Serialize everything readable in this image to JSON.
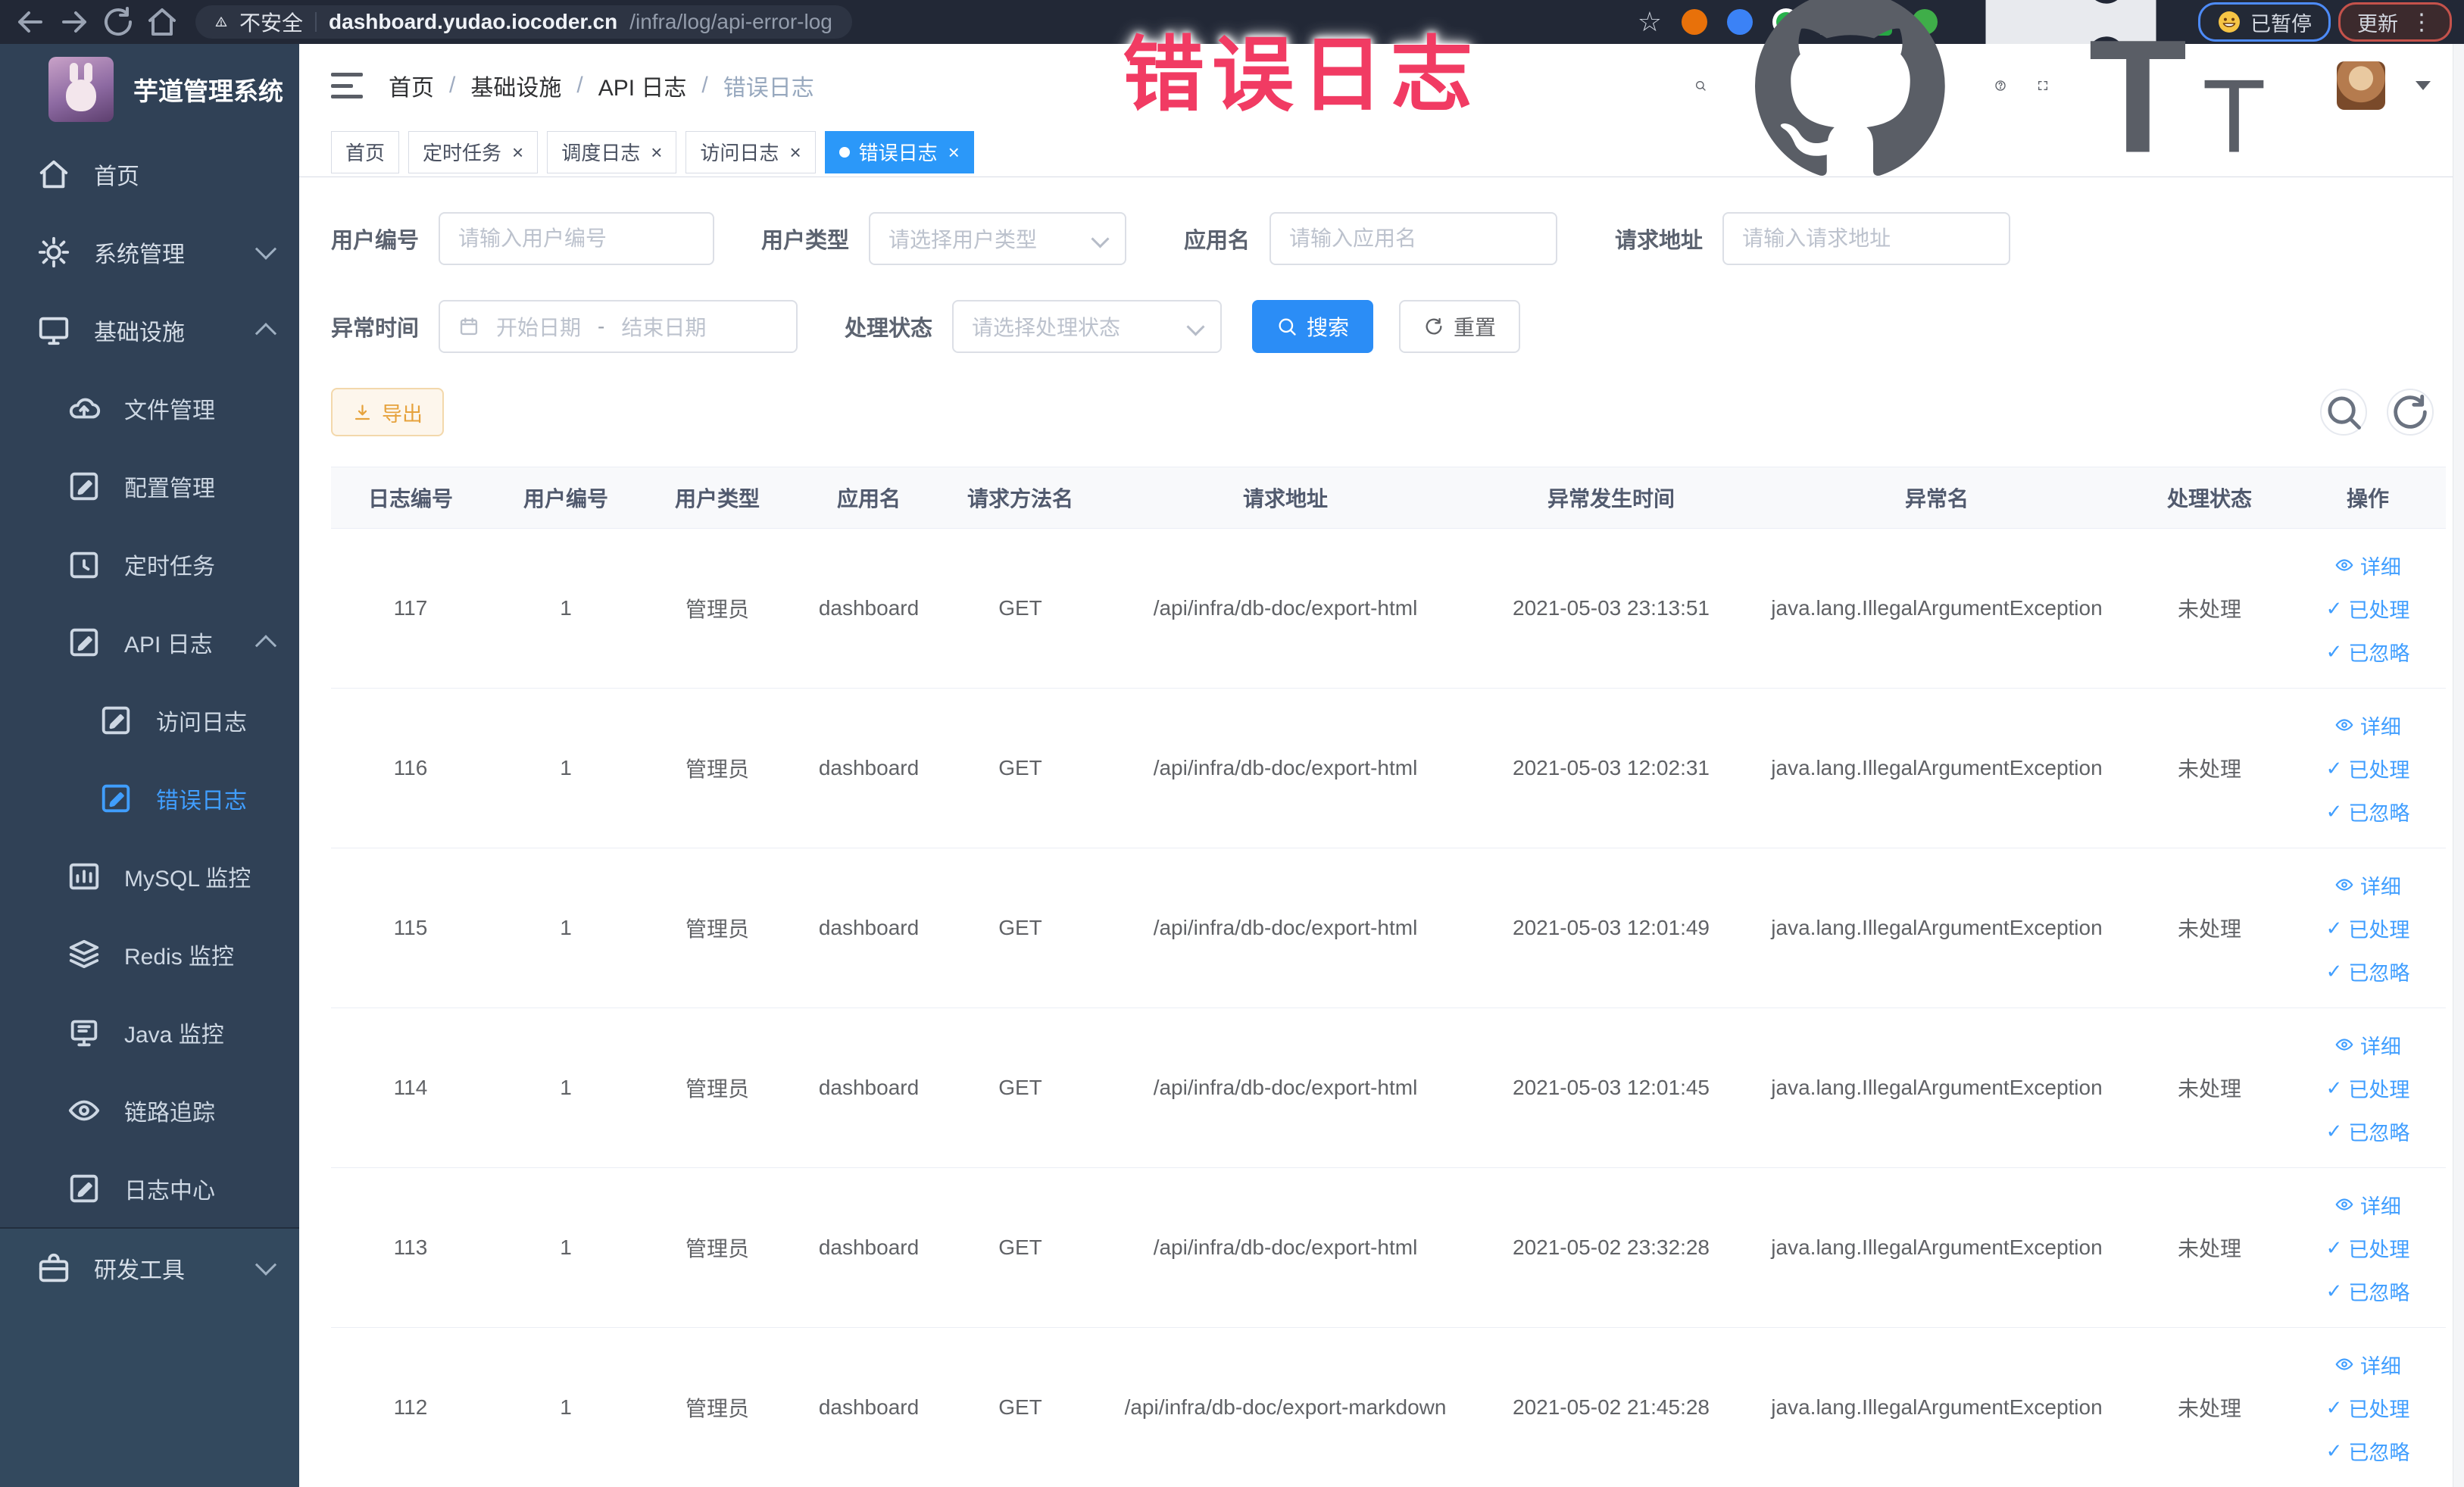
{
  "colors": {
    "accent": "#409eff",
    "annotation": "#f13b63",
    "warning": "#e6a23c",
    "sidebar_bg": "#304156",
    "tab_active": "#2b98f9"
  },
  "annotation": {
    "text": "错误日志"
  },
  "browser": {
    "insecure_label": "不安全",
    "url_host": "dashboard.yudao.iocoder.cn",
    "url_path": "/infra/log/api-error-log",
    "paused_pill": "已暂停",
    "update_pill": "更新",
    "extensions": [
      {
        "name": "bookmark-star-icon",
        "type": "star"
      },
      {
        "name": "extension-orange-icon",
        "type": "dot",
        "color": "#e8710a"
      },
      {
        "name": "extension-blue-shield-icon",
        "type": "dot",
        "color": "#3b82f6"
      },
      {
        "name": "extension-green-icon",
        "type": "ring",
        "color": "#27b04b"
      },
      {
        "name": "extension-grid-icon",
        "type": "grid"
      },
      {
        "name": "git-extension-icon",
        "type": "git",
        "label": "GIT"
      },
      {
        "name": "extension-plant-icon",
        "type": "dot",
        "color": "#3fae49"
      },
      {
        "name": "puzzle-extensions-icon",
        "type": "puzzle"
      }
    ]
  },
  "sidebar": {
    "title": "芋道管理系统",
    "menu": [
      {
        "label": "首页",
        "icon": "home-icon",
        "level": 1
      },
      {
        "label": "系统管理",
        "icon": "gear-icon",
        "level": 1,
        "chevron": "down"
      },
      {
        "label": "基础设施",
        "icon": "monitor-icon",
        "level": 1,
        "chevron": "up"
      },
      {
        "label": "文件管理",
        "icon": "cloud-upload-icon",
        "level": 2
      },
      {
        "label": "配置管理",
        "icon": "edit-square-icon",
        "level": 2
      },
      {
        "label": "定时任务",
        "icon": "schedule-icon",
        "level": 2
      },
      {
        "label": "API 日志",
        "icon": "edit-square-icon",
        "level": 2,
        "chevron": "up"
      },
      {
        "label": "访问日志",
        "icon": "edit-square-icon",
        "level": 3
      },
      {
        "label": "错误日志",
        "icon": "edit-square-icon",
        "level": 3,
        "active": true
      },
      {
        "label": "MySQL 监控",
        "icon": "chart-icon",
        "level": 2
      },
      {
        "label": "Redis 监控",
        "icon": "layers-icon",
        "level": 2
      },
      {
        "label": "Java 监控",
        "icon": "java-monitor-icon",
        "level": 2
      },
      {
        "label": "链路追踪",
        "icon": "eye-icon",
        "level": 2
      },
      {
        "label": "日志中心",
        "icon": "edit-square-icon",
        "level": 2
      },
      {
        "label": "研发工具",
        "icon": "briefcase-icon",
        "level": 1,
        "chevron": "down",
        "section": true
      }
    ]
  },
  "breadcrumb": [
    "首页",
    "基础设施",
    "API 日志",
    "错误日志"
  ],
  "tabs": [
    {
      "label": "首页",
      "closable": false,
      "active": false
    },
    {
      "label": "定时任务",
      "closable": true,
      "active": false
    },
    {
      "label": "调度日志",
      "closable": true,
      "active": false
    },
    {
      "label": "访问日志",
      "closable": true,
      "active": false
    },
    {
      "label": "错误日志",
      "closable": true,
      "active": true
    }
  ],
  "filters": {
    "user_id": {
      "label": "用户编号",
      "placeholder": "请输入用户编号"
    },
    "user_type": {
      "label": "用户类型",
      "placeholder": "请选择用户类型"
    },
    "app_name": {
      "label": "应用名",
      "placeholder": "请输入应用名"
    },
    "request_url": {
      "label": "请求地址",
      "placeholder": "请输入请求地址"
    },
    "exception_time": {
      "label": "异常时间",
      "start_placeholder": "开始日期",
      "separator": "-",
      "end_placeholder": "结束日期"
    },
    "process_status": {
      "label": "处理状态",
      "placeholder": "请选择处理状态"
    },
    "search_button": "搜索",
    "reset_button": "重置"
  },
  "toolbar": {
    "export_button": "导出"
  },
  "table": {
    "headers": [
      "日志编号",
      "用户编号",
      "用户类型",
      "应用名",
      "请求方法名",
      "请求地址",
      "异常发生时间",
      "异常名",
      "处理状态",
      "操作"
    ],
    "actions": [
      "详细",
      "已处理",
      "已忽略"
    ],
    "rows": [
      {
        "id": "117",
        "user_id": "1",
        "user_type": "管理员",
        "app": "dashboard",
        "method": "GET",
        "url": "/api/infra/db-doc/export-html",
        "time": "2021-05-03 23:13:51",
        "exception": "java.lang.IllegalArgumentException",
        "status": "未处理"
      },
      {
        "id": "116",
        "user_id": "1",
        "user_type": "管理员",
        "app": "dashboard",
        "method": "GET",
        "url": "/api/infra/db-doc/export-html",
        "time": "2021-05-03 12:02:31",
        "exception": "java.lang.IllegalArgumentException",
        "status": "未处理"
      },
      {
        "id": "115",
        "user_id": "1",
        "user_type": "管理员",
        "app": "dashboard",
        "method": "GET",
        "url": "/api/infra/db-doc/export-html",
        "time": "2021-05-03 12:01:49",
        "exception": "java.lang.IllegalArgumentException",
        "status": "未处理"
      },
      {
        "id": "114",
        "user_id": "1",
        "user_type": "管理员",
        "app": "dashboard",
        "method": "GET",
        "url": "/api/infra/db-doc/export-html",
        "time": "2021-05-03 12:01:45",
        "exception": "java.lang.IllegalArgumentException",
        "status": "未处理"
      },
      {
        "id": "113",
        "user_id": "1",
        "user_type": "管理员",
        "app": "dashboard",
        "method": "GET",
        "url": "/api/infra/db-doc/export-html",
        "time": "2021-05-02 23:32:28",
        "exception": "java.lang.IllegalArgumentException",
        "status": "未处理"
      },
      {
        "id": "112",
        "user_id": "1",
        "user_type": "管理员",
        "app": "dashboard",
        "method": "GET",
        "url": "/api/infra/db-doc/export-markdown",
        "time": "2021-05-02 21:45:28",
        "exception": "java.lang.IllegalArgumentException",
        "status": "未处理"
      }
    ]
  }
}
